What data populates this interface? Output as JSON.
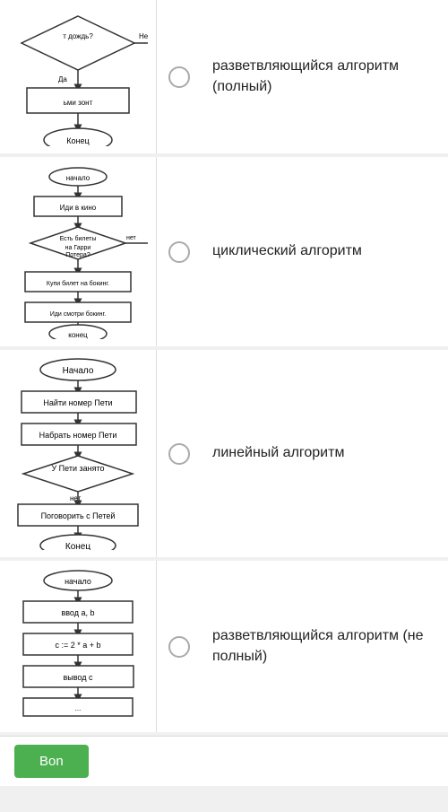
{
  "items": [
    {
      "id": "item1",
      "label": "разветвляющийся алгоритм (полный)",
      "diagram_type": "branching_full"
    },
    {
      "id": "item2",
      "label": "циклический алгоритм",
      "diagram_type": "cyclic"
    },
    {
      "id": "item3",
      "label": "линейный алгоритм",
      "diagram_type": "linear"
    },
    {
      "id": "item4",
      "label": "разветвляющийся алгоритм (не полный)",
      "diagram_type": "branching_partial"
    }
  ],
  "bottom": {
    "button_label": "Bon"
  }
}
